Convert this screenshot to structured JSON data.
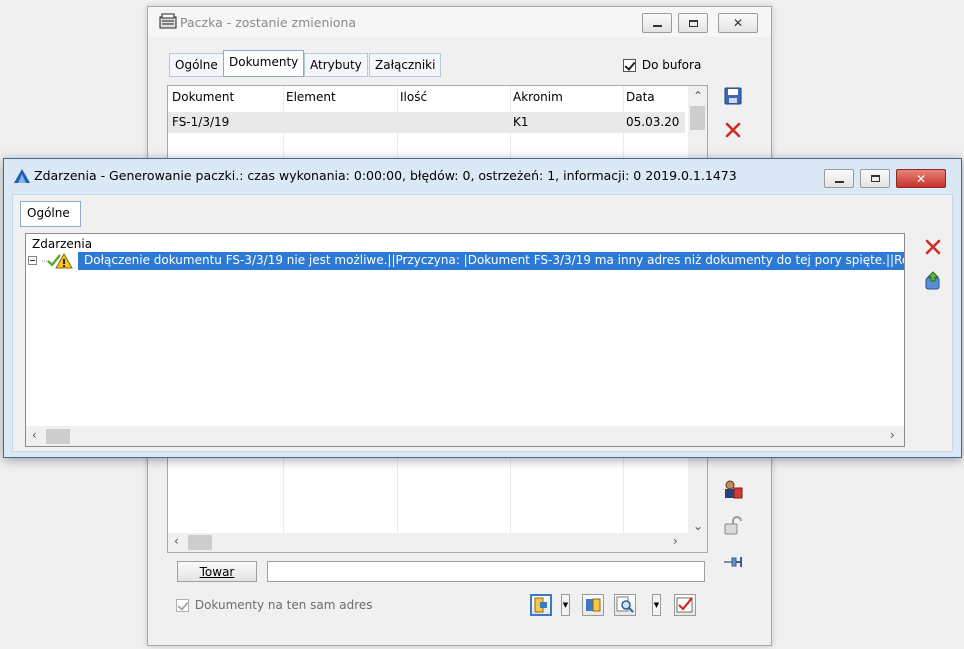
{
  "window_back": {
    "title": "Paczka - zostanie zmieniona",
    "tabs": [
      "Ogólne",
      "Dokumenty",
      "Atrybuty",
      "Załączniki"
    ],
    "active_tab": "Dokumenty",
    "do_bufora_label": "Do bufora",
    "do_bufora_checked": true,
    "columns": [
      "Dokument",
      "Element",
      "Ilość",
      "Akronim",
      "Data"
    ],
    "rows": [
      {
        "dokument": "FS-1/3/19",
        "element": "",
        "ilosc": "",
        "akronim": "K1",
        "data": "05.03.20"
      }
    ],
    "towar_button": "Towar",
    "towar_value": "",
    "same_address_label": "Dokumenty na ten sam adres",
    "same_address_checked": true
  },
  "window_front": {
    "title": "Zdarzenia - Generowanie paczki.: czas wykonania:  0:00:00, błędów: 0, ostrzeżeń: 1, informacji: 0 2019.0.1.1473",
    "tab": "Ogólne",
    "list_header": "Zdarzenia",
    "event_text": "Dołączenie dokumentu FS-3/3/19 nie jest możliwe.||Przyczyna: |Dokument FS-3/3/19 ma inny adres niż dokumenty do tej pory spięte.||Rem"
  },
  "colors": {
    "selection": "#2d7ad6",
    "close_red": "#c9302c",
    "front_border": "#3f6a9a"
  }
}
